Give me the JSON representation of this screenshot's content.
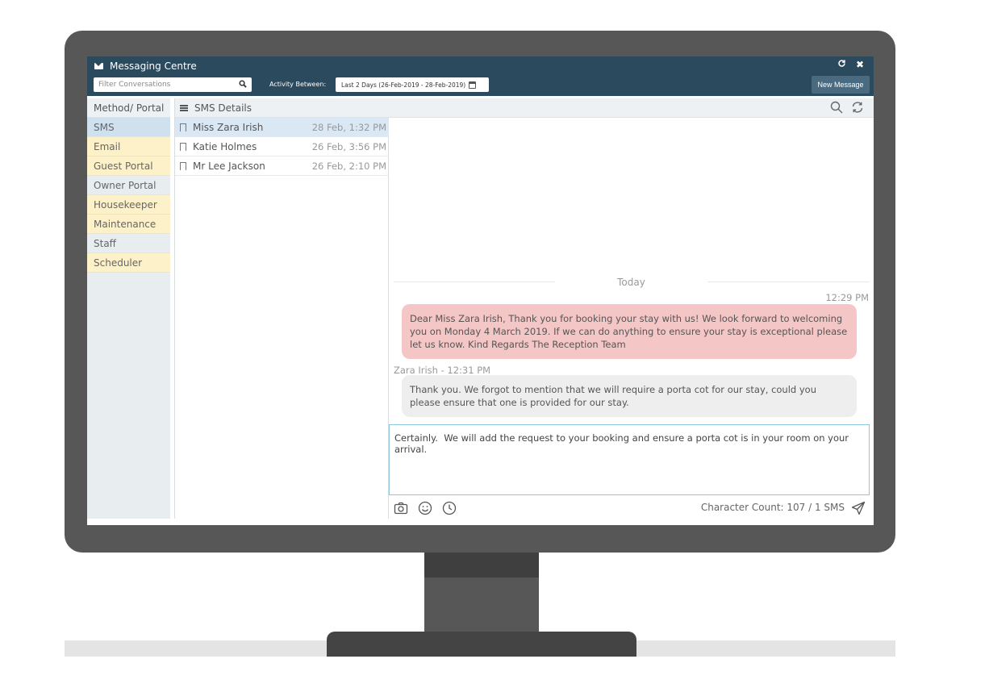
{
  "window": {
    "title": "Messaging Centre"
  },
  "toolbar": {
    "filter_placeholder": "Filter Conversations",
    "activity_label": "Activity Between:",
    "date_range": "Last 2 Days (26-Feb-2019 - 28-Feb-2019)",
    "new_message_label": "New Message"
  },
  "sidebar": {
    "header": "Method/ Portal",
    "items": [
      {
        "label": "SMS",
        "color": "#cfe1ef"
      },
      {
        "label": "Email",
        "color": "#fcf1c8"
      },
      {
        "label": "Guest Portal",
        "color": "#fcf1c8"
      },
      {
        "label": "Owner Portal",
        "color": "#e8edf0"
      },
      {
        "label": "Housekeeper",
        "color": "#fcf1c8"
      },
      {
        "label": "Maintenance",
        "color": "#fcf1c8"
      },
      {
        "label": "Staff",
        "color": "#e8edf0"
      },
      {
        "label": "Scheduler",
        "color": "#fcf1c8"
      }
    ]
  },
  "conversations": {
    "header": "SMS Details",
    "rows": [
      {
        "name": "Miss Zara Irish",
        "time": "28 Feb, 1:32 PM",
        "selected": true
      },
      {
        "name": "Katie Holmes",
        "time": "26 Feb, 3:56 PM",
        "selected": false
      },
      {
        "name": "Mr Lee Jackson",
        "time": "26 Feb, 2:10 PM",
        "selected": false
      }
    ]
  },
  "thread": {
    "day_separator": "Today",
    "outgoing_time": "12:29 PM",
    "outgoing_text": "Dear Miss Zara Irish, Thank you for booking your stay with us! We look forward to welcoming you on Monday 4 March 2019. If we can do anything to ensure your stay is exceptional please let us know. Kind Regards The Reception Team",
    "incoming_sender": "Zara Irish - 12:31 PM",
    "incoming_text": "Thank you. We forgot to mention that we will require a porta cot for our stay, could you please ensure that one is provided for our stay.",
    "composer_text": "Certainly.  We will add the request to your booking and ensure a porta cot is in your room on your arrival.",
    "character_count": "Character Count: 107 / 1 SMS"
  },
  "colors": {
    "titlebar": "#2c4a5e",
    "outgoing_bubble": "#f4c6c6",
    "incoming_bubble": "#eeeeef",
    "selected_row": "#d9e8f4"
  },
  "icons": {
    "title": "envelope-icon",
    "window_refresh": "refresh-icon",
    "window_close": "close-icon",
    "filter_search": "search-icon",
    "calendar": "calendar-icon",
    "list_menu": "menu-icon",
    "bookmark": "bookmark-icon",
    "camera": "camera-icon",
    "emoji": "smiley-icon",
    "schedule": "clock-icon",
    "send": "send-icon"
  }
}
